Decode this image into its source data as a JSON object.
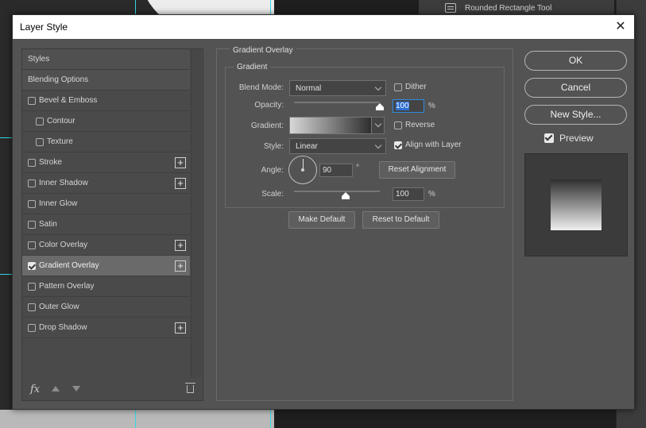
{
  "background": {
    "tool_label": "Rounded Rectangle Tool"
  },
  "dialog": {
    "title": "Layer Style",
    "close_glyph": "✕"
  },
  "styles_list": {
    "items": [
      {
        "label": "Styles",
        "type": "header",
        "checked": null,
        "plus": false
      },
      {
        "label": "Blending Options",
        "type": "header",
        "checked": null,
        "plus": false
      },
      {
        "label": "Bevel & Emboss",
        "type": "item",
        "checked": false,
        "plus": false
      },
      {
        "label": "Contour",
        "type": "sub",
        "checked": false,
        "plus": false
      },
      {
        "label": "Texture",
        "type": "sub",
        "checked": false,
        "plus": false
      },
      {
        "label": "Stroke",
        "type": "item",
        "checked": false,
        "plus": true
      },
      {
        "label": "Inner Shadow",
        "type": "item",
        "checked": false,
        "plus": true
      },
      {
        "label": "Inner Glow",
        "type": "item",
        "checked": false,
        "plus": false
      },
      {
        "label": "Satin",
        "type": "item",
        "checked": false,
        "plus": false
      },
      {
        "label": "Color Overlay",
        "type": "item",
        "checked": false,
        "plus": true
      },
      {
        "label": "Gradient Overlay",
        "type": "item",
        "checked": true,
        "plus": true,
        "selected": true
      },
      {
        "label": "Pattern Overlay",
        "type": "item",
        "checked": false,
        "plus": false
      },
      {
        "label": "Outer Glow",
        "type": "item",
        "checked": false,
        "plus": false
      },
      {
        "label": "Drop Shadow",
        "type": "item",
        "checked": false,
        "plus": true
      }
    ],
    "footer": {
      "fx_label": "fx"
    }
  },
  "gradient_overlay": {
    "section_title": "Gradient Overlay",
    "group_title": "Gradient",
    "blend_mode_label": "Blend Mode:",
    "blend_mode_value": "Normal",
    "dither_label": "Dither",
    "dither_checked": false,
    "opacity_label": "Opacity:",
    "opacity_value": "100",
    "opacity_unit": "%",
    "gradient_label": "Gradient:",
    "reverse_label": "Reverse",
    "reverse_checked": false,
    "style_label": "Style:",
    "style_value": "Linear",
    "align_label": "Align with Layer",
    "align_checked": true,
    "angle_label": "Angle:",
    "angle_value": "90",
    "angle_unit": "°",
    "reset_alignment_label": "Reset Alignment",
    "scale_label": "Scale:",
    "scale_value": "100",
    "scale_unit": "%",
    "make_default_label": "Make Default",
    "reset_default_label": "Reset to Default",
    "gradient_colors": [
      "#d8d8d8",
      "#2e2e2e"
    ]
  },
  "right_panel": {
    "ok_label": "OK",
    "cancel_label": "Cancel",
    "new_style_label": "New Style...",
    "preview_label": "Preview",
    "preview_checked": true
  }
}
